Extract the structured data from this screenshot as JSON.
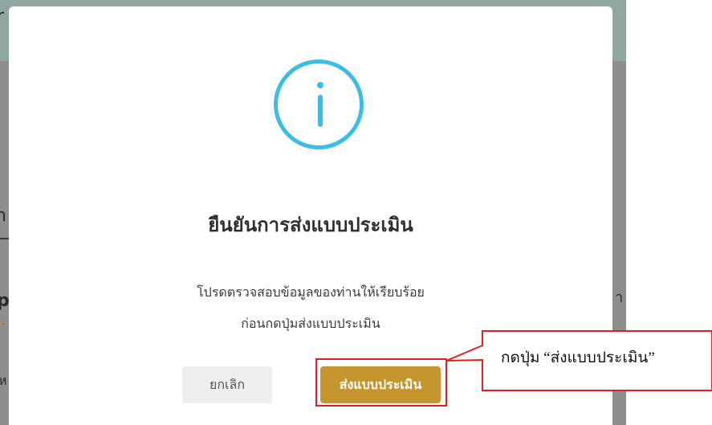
{
  "background": {
    "fragments": [
      "r",
      "n",
      "p",
      "่",
      "ห",
      "า"
    ]
  },
  "modal": {
    "icon": "info-icon",
    "title": "ยืนยันการส่งแบบประเมิน",
    "message_line1": "โปรดตรวจสอบข้อมูลของท่านให้เรียบร้อย",
    "message_line2": "ก่อนกดปุ่มส่งแบบประเมิน",
    "cancel_label": "ยกเลิก",
    "submit_label": "ส่งแบบประเมิน"
  },
  "annotation": {
    "callout_text": "กดปุ่ม “ส่งแบบประเมิน”"
  },
  "colors": {
    "accent": "#3cbde6",
    "submit": "#c5962e",
    "highlight": "#e0201e"
  }
}
